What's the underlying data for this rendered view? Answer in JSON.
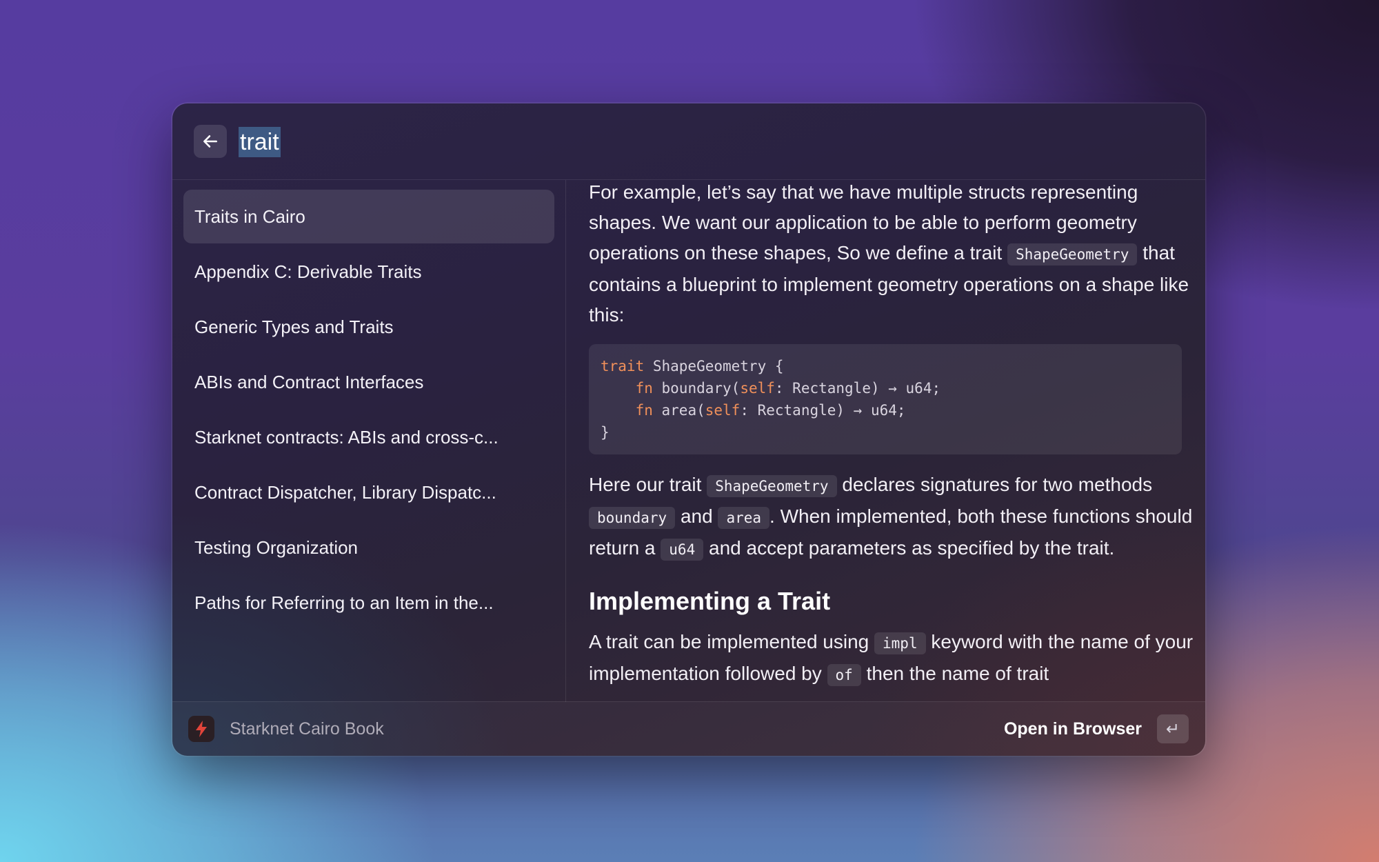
{
  "header": {
    "search_value": "trait"
  },
  "sidebar": {
    "items": [
      {
        "label": "Traits in Cairo",
        "active": true
      },
      {
        "label": "Appendix C: Derivable Traits"
      },
      {
        "label": "Generic Types and Traits"
      },
      {
        "label": "ABIs and Contract Interfaces"
      },
      {
        "label": "Starknet contracts: ABIs and cross-c..."
      },
      {
        "label": "Contract Dispatcher, Library Dispatc..."
      },
      {
        "label": "Testing Organization"
      },
      {
        "label": "Paths for Referring to an Item in the..."
      }
    ]
  },
  "content": {
    "p1": {
      "t1": "For example, let’s say that we have multiple structs representing shapes. We want our application to be able to perform geometry operations on these shapes, So we define a trait",
      "c1": "ShapeGeometry",
      "t2": "that contains a blueprint to implement geometry operations on a shape like this:"
    },
    "code": {
      "l1_kw": "trait",
      "l1_rest": " ShapeGeometry {",
      "l2_indent": "    ",
      "l2_kw": "fn",
      "l2_a": " boundary(",
      "l2_self": "self",
      "l2_b": ": Rectangle) → u64;",
      "l3_indent": "    ",
      "l3_kw": "fn",
      "l3_a": " area(",
      "l3_self": "self",
      "l3_b": ": Rectangle) → u64;",
      "l4": "}"
    },
    "p2": {
      "t1": "Here our trait",
      "c1": "ShapeGeometry",
      "t2": "declares signatures for two methods",
      "c2": "boundary",
      "t3": "and",
      "c3": "area",
      "t4": ". When implemented, both these functions should return a",
      "c4": "u64",
      "t5": "and accept parameters as specified by the trait."
    },
    "heading": "Implementing a Trait",
    "p3": {
      "t1": "A trait can be implemented using",
      "c1": "impl",
      "t2": "keyword with the name of your implementation followed by",
      "c2": "of",
      "t3": "then the name of trait"
    }
  },
  "footer": {
    "app_name": "Starknet Cairo Book",
    "action_label": "Open in Browser",
    "enter_glyph": "↵"
  },
  "colors": {
    "keyword": "#f0905a",
    "search_highlight": "#3e5a84",
    "app_icon_bolt": "#e0443a"
  },
  "icons": {
    "back": "arrow-left-icon",
    "app": "lightning-bolt-icon",
    "enter": "return-key-icon"
  }
}
